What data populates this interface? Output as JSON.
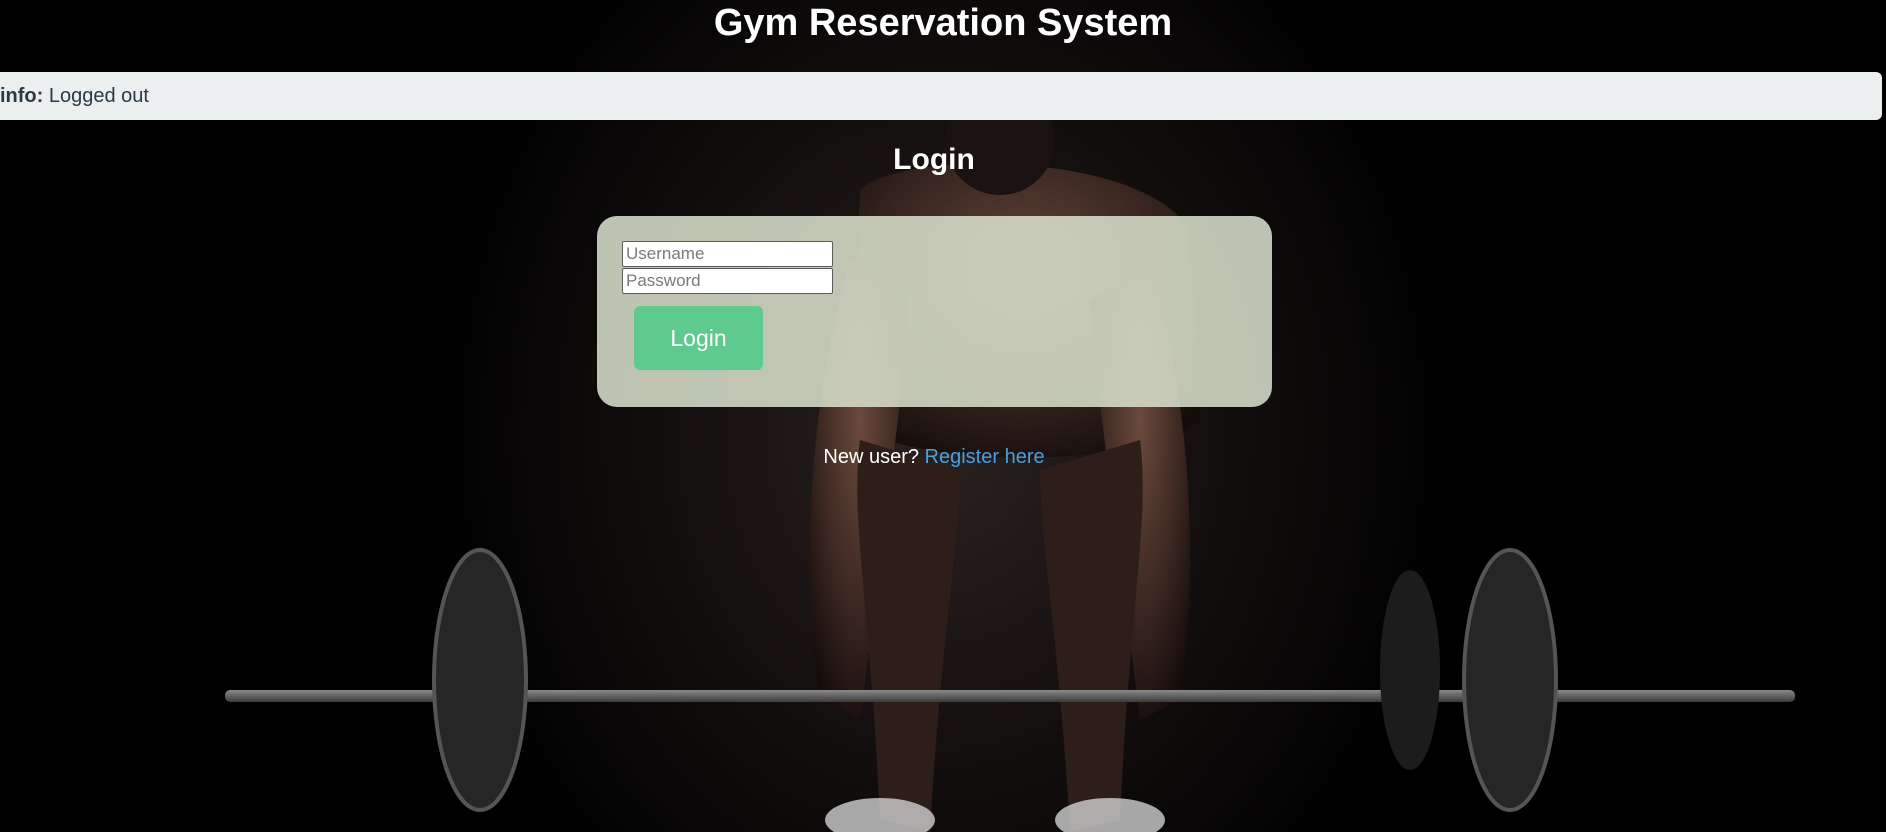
{
  "header": {
    "title": "Gym Reservation System"
  },
  "flash": {
    "label": "info:",
    "message": "Logged out"
  },
  "login": {
    "title": "Login",
    "username": {
      "placeholder": "Username",
      "value": ""
    },
    "password": {
      "placeholder": "Password",
      "value": ""
    },
    "submit_label": "Login"
  },
  "register": {
    "prompt": "New user?",
    "link_label": "Register here"
  },
  "colors": {
    "page_background": "#000000",
    "flash_background": "#ebeff0",
    "card_background": "#d7decb",
    "login_button": "#5fca8e",
    "link": "#4a9fe0"
  }
}
